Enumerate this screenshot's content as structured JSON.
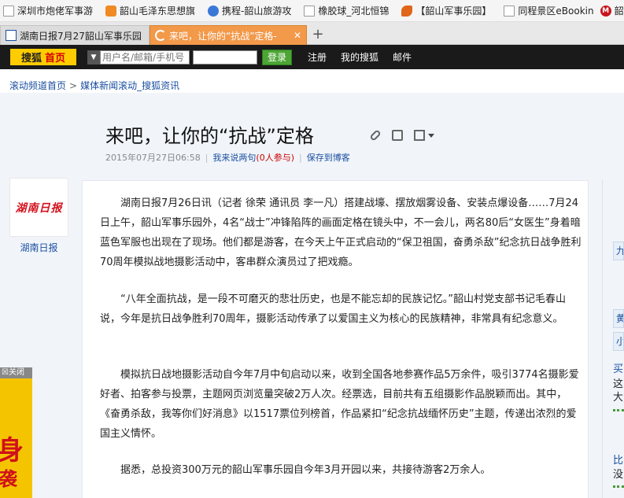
{
  "bookmarks": [
    {
      "label": "深圳市炮佬军事游",
      "icon": "page-icon"
    },
    {
      "label": "韶山毛泽东思想旗",
      "icon": "bookmark-orange-icon"
    },
    {
      "label": "携程-韶山旅游攻",
      "icon": "ctrip-icon"
    },
    {
      "label": "橡胶球_河北恒锦",
      "icon": "page-icon"
    },
    {
      "label": "【韶山军事乐园】",
      "icon": "fruit-icon"
    },
    {
      "label": "同程景区eBookin",
      "icon": "page-icon"
    },
    {
      "label": "韶",
      "icon": "red-logo-icon"
    }
  ],
  "tabs": [
    {
      "title": "湖南日报7月27韶山军事乐园",
      "active": false
    },
    {
      "title": "来吧，让你的“抗战”定格-",
      "active": true
    }
  ],
  "sohu_bar": {
    "logo": "搜狐",
    "home": "首页",
    "username_placeholder": "用户名/邮箱/手机号",
    "login": "登录",
    "links": [
      "注册",
      "我的搜狐",
      "邮件"
    ]
  },
  "breadcrumb": [
    "滚动频道首页",
    "媒体新闻滚动_搜狐资讯"
  ],
  "article": {
    "title": "来吧，让你的“抗战”定格",
    "date": "2015年07月27日06:58",
    "comment_prefix": "我来说两句",
    "comment_count": "(0人参与)",
    "save_blog": "保存到博客",
    "source": {
      "logo": "湖南日报",
      "name": "湖南日报"
    },
    "paragraphs": [
      "湖南日报7月26日讯（记者 徐荣 通讯员 李一凡）搭建战壕、摆放烟雾设备、安装点爆设备……7月24日上午，韶山军事乐园外，4名“战士”冲锋陷阵的画面定格在镜头中，不一会儿，两名80后“女医生”身着暗蓝色军服也出现在了现场。他们都是游客，在今天上午正式启动的“保卫祖国，奋勇杀敌”纪念抗日战争胜利70周年模拟战地摄影活动中，客串群众演员过了把戏瘾。",
      "“八年全面抗战，是一段不可磨灭的悲壮历史，也是不能忘却的民族记忆。”韶山村党支部书记毛春山说，今年是抗日战争胜利70周年，摄影活动传承了以爱国主义为核心的民族精神，非常具有纪念意义。",
      "模拟抗日战地摄影活动自今年7月中旬启动以来，收到全国各地参赛作品5万余件，吸引3774名摄影爱好者、拍客参与投票，主题网页浏览量突破2万人次。经票选，目前共有五组摄影作品脱颖而出。其中，《奋勇杀敌，我等你们好消息》以1517票位列榜首，作品紧扣“纪念抗战缅怀历史”主题，传递出浓烈的爱国主义情怀。",
      "据悉，总投资300万元的韶山军事乐园自今年3月开园以来，共接待游客2万余人。"
    ]
  },
  "right_rail": {
    "boxes": [
      "九",
      "黄",
      "小"
    ],
    "text_items": [
      "买",
      "这",
      "大",
      "比",
      "没"
    ]
  },
  "ad": {
    "close": "关闭",
    "big": "身",
    "small": "袭"
  }
}
